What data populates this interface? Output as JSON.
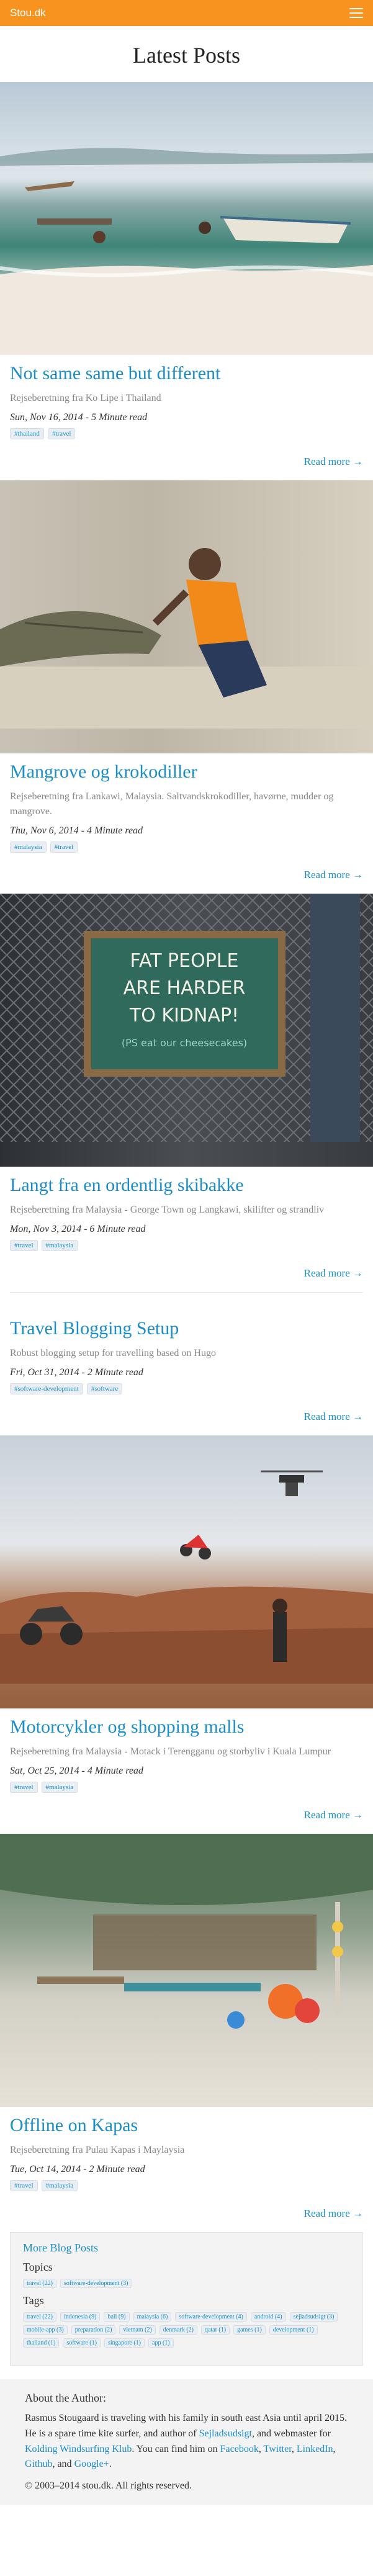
{
  "header": {
    "brand": "Stou.dk"
  },
  "page": {
    "title": "Latest Posts"
  },
  "posts": [
    {
      "title": "Not same same but different",
      "subtitle": "Rejseberetning fra Ko Lipe i Thailand",
      "meta": "Sun, Nov 16, 2014 - 5 Minute read",
      "tags": [
        "#thailand",
        "#travel"
      ],
      "read_more": "Read more →",
      "has_image": true
    },
    {
      "title": "Mangrove og krokodiller",
      "subtitle": "Rejseberetning fra Lankawi, Malaysia. Saltvandskrokodiller, havørne, mudder og mangrove.",
      "meta": "Thu, Nov 6, 2014 - 4 Minute read",
      "tags": [
        "#malaysia",
        "#travel"
      ],
      "read_more": "Read more →",
      "has_image": true
    },
    {
      "title": "Langt fra en ordentlig skibakke",
      "subtitle": "Rejseberetning fra Malaysia - George Town og Langkawi, skilifter og strandliv",
      "meta": "Mon, Nov 3, 2014 - 6 Minute read",
      "tags": [
        "#travel",
        "#malaysia"
      ],
      "read_more": "Read more →",
      "has_image": true,
      "sign_text": [
        "FAT PEOPLE",
        "ARE HARDER",
        "TO KIDNAP!",
        "(PS eat our cheesecakes)"
      ]
    },
    {
      "title": "Travel Blogging Setup",
      "subtitle": "Robust blogging setup for travelling based on Hugo",
      "meta": "Fri, Oct 31, 2014 - 2 Minute read",
      "tags": [
        "#software-development",
        "#software"
      ],
      "read_more": "Read more →",
      "has_image": false
    },
    {
      "title": "Motorcykler og shopping malls",
      "subtitle": "Rejseberetning fra Malaysia - Motack i Terengganu og storbyliv i Kuala Lumpur",
      "meta": "Sat, Oct 25, 2014 - 4 Minute read",
      "tags": [
        "#travel",
        "#malaysia"
      ],
      "read_more": "Read more →",
      "has_image": true
    },
    {
      "title": "Offline on Kapas",
      "subtitle": "Rejseberetning fra Pulau Kapas i Maylaysia",
      "meta": "Tue, Oct 14, 2014 - 2 Minute read",
      "tags": [
        "#travel",
        "#malaysia"
      ],
      "read_more": "Read more →",
      "has_image": true
    }
  ],
  "more_posts": {
    "title": "More Blog Posts",
    "topics_heading": "Topics",
    "topics": [
      "travel (22)",
      "software-development (3)"
    ],
    "tags_heading": "Tags",
    "tags": [
      "travel (22)",
      "indonesia (9)",
      "bali (9)",
      "malaysia (6)",
      "software-development (4)",
      "android (4)",
      "sejladsudsigt (3)",
      "mobile-app (3)",
      "preparation (2)",
      "vietnam (2)",
      "denmark (2)",
      "qatar (1)",
      "games (1)",
      "development (1)",
      "thailand (1)",
      "software (1)",
      "singapore (1)",
      "app (1)"
    ]
  },
  "about": {
    "heading": "About the Author:",
    "text_1": "Rasmus Stougaard is traveling with his family in south east Asia until april 2015. He is a spare time kite surfer, and author of ",
    "link_sejlads": "Sejladsudsigt",
    "text_2": ", and webmaster for ",
    "link_klub": "Kolding Windsurfing Klub",
    "text_3": ". You can find him on ",
    "link_facebook": "Facebook",
    "sep1": ", ",
    "link_twitter": "Twitter",
    "sep2": ", ",
    "link_linkedin": "LinkedIn",
    "sep3": ", ",
    "link_github": "Github",
    "sep4": ", and ",
    "link_gplus": "Google+",
    "text_end": ".",
    "copyright": "© 2003–2014 stou.dk. All rights reserved."
  }
}
